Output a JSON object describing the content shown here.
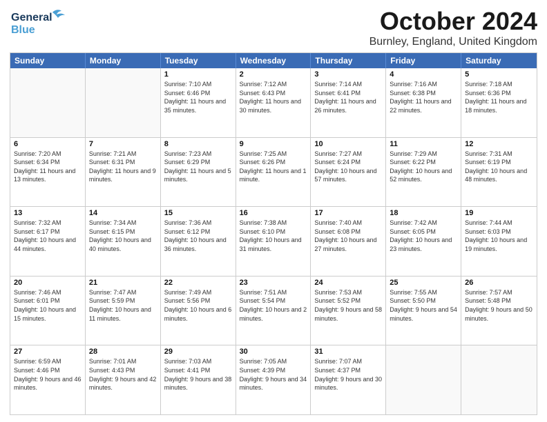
{
  "header": {
    "logo_line1": "General",
    "logo_line2": "Blue",
    "title": "October 2024",
    "subtitle": "Burnley, England, United Kingdom"
  },
  "calendar": {
    "days": [
      "Sunday",
      "Monday",
      "Tuesday",
      "Wednesday",
      "Thursday",
      "Friday",
      "Saturday"
    ],
    "rows": [
      [
        {
          "day": "",
          "sunrise": "",
          "sunset": "",
          "daylight": "",
          "empty": true
        },
        {
          "day": "",
          "sunrise": "",
          "sunset": "",
          "daylight": "",
          "empty": true
        },
        {
          "day": "1",
          "sunrise": "Sunrise: 7:10 AM",
          "sunset": "Sunset: 6:46 PM",
          "daylight": "Daylight: 11 hours and 35 minutes."
        },
        {
          "day": "2",
          "sunrise": "Sunrise: 7:12 AM",
          "sunset": "Sunset: 6:43 PM",
          "daylight": "Daylight: 11 hours and 30 minutes."
        },
        {
          "day": "3",
          "sunrise": "Sunrise: 7:14 AM",
          "sunset": "Sunset: 6:41 PM",
          "daylight": "Daylight: 11 hours and 26 minutes."
        },
        {
          "day": "4",
          "sunrise": "Sunrise: 7:16 AM",
          "sunset": "Sunset: 6:38 PM",
          "daylight": "Daylight: 11 hours and 22 minutes."
        },
        {
          "day": "5",
          "sunrise": "Sunrise: 7:18 AM",
          "sunset": "Sunset: 6:36 PM",
          "daylight": "Daylight: 11 hours and 18 minutes."
        }
      ],
      [
        {
          "day": "6",
          "sunrise": "Sunrise: 7:20 AM",
          "sunset": "Sunset: 6:34 PM",
          "daylight": "Daylight: 11 hours and 13 minutes."
        },
        {
          "day": "7",
          "sunrise": "Sunrise: 7:21 AM",
          "sunset": "Sunset: 6:31 PM",
          "daylight": "Daylight: 11 hours and 9 minutes."
        },
        {
          "day": "8",
          "sunrise": "Sunrise: 7:23 AM",
          "sunset": "Sunset: 6:29 PM",
          "daylight": "Daylight: 11 hours and 5 minutes."
        },
        {
          "day": "9",
          "sunrise": "Sunrise: 7:25 AM",
          "sunset": "Sunset: 6:26 PM",
          "daylight": "Daylight: 11 hours and 1 minute."
        },
        {
          "day": "10",
          "sunrise": "Sunrise: 7:27 AM",
          "sunset": "Sunset: 6:24 PM",
          "daylight": "Daylight: 10 hours and 57 minutes."
        },
        {
          "day": "11",
          "sunrise": "Sunrise: 7:29 AM",
          "sunset": "Sunset: 6:22 PM",
          "daylight": "Daylight: 10 hours and 52 minutes."
        },
        {
          "day": "12",
          "sunrise": "Sunrise: 7:31 AM",
          "sunset": "Sunset: 6:19 PM",
          "daylight": "Daylight: 10 hours and 48 minutes."
        }
      ],
      [
        {
          "day": "13",
          "sunrise": "Sunrise: 7:32 AM",
          "sunset": "Sunset: 6:17 PM",
          "daylight": "Daylight: 10 hours and 44 minutes."
        },
        {
          "day": "14",
          "sunrise": "Sunrise: 7:34 AM",
          "sunset": "Sunset: 6:15 PM",
          "daylight": "Daylight: 10 hours and 40 minutes."
        },
        {
          "day": "15",
          "sunrise": "Sunrise: 7:36 AM",
          "sunset": "Sunset: 6:12 PM",
          "daylight": "Daylight: 10 hours and 36 minutes."
        },
        {
          "day": "16",
          "sunrise": "Sunrise: 7:38 AM",
          "sunset": "Sunset: 6:10 PM",
          "daylight": "Daylight: 10 hours and 31 minutes."
        },
        {
          "day": "17",
          "sunrise": "Sunrise: 7:40 AM",
          "sunset": "Sunset: 6:08 PM",
          "daylight": "Daylight: 10 hours and 27 minutes."
        },
        {
          "day": "18",
          "sunrise": "Sunrise: 7:42 AM",
          "sunset": "Sunset: 6:05 PM",
          "daylight": "Daylight: 10 hours and 23 minutes."
        },
        {
          "day": "19",
          "sunrise": "Sunrise: 7:44 AM",
          "sunset": "Sunset: 6:03 PM",
          "daylight": "Daylight: 10 hours and 19 minutes."
        }
      ],
      [
        {
          "day": "20",
          "sunrise": "Sunrise: 7:46 AM",
          "sunset": "Sunset: 6:01 PM",
          "daylight": "Daylight: 10 hours and 15 minutes."
        },
        {
          "day": "21",
          "sunrise": "Sunrise: 7:47 AM",
          "sunset": "Sunset: 5:59 PM",
          "daylight": "Daylight: 10 hours and 11 minutes."
        },
        {
          "day": "22",
          "sunrise": "Sunrise: 7:49 AM",
          "sunset": "Sunset: 5:56 PM",
          "daylight": "Daylight: 10 hours and 6 minutes."
        },
        {
          "day": "23",
          "sunrise": "Sunrise: 7:51 AM",
          "sunset": "Sunset: 5:54 PM",
          "daylight": "Daylight: 10 hours and 2 minutes."
        },
        {
          "day": "24",
          "sunrise": "Sunrise: 7:53 AM",
          "sunset": "Sunset: 5:52 PM",
          "daylight": "Daylight: 9 hours and 58 minutes."
        },
        {
          "day": "25",
          "sunrise": "Sunrise: 7:55 AM",
          "sunset": "Sunset: 5:50 PM",
          "daylight": "Daylight: 9 hours and 54 minutes."
        },
        {
          "day": "26",
          "sunrise": "Sunrise: 7:57 AM",
          "sunset": "Sunset: 5:48 PM",
          "daylight": "Daylight: 9 hours and 50 minutes."
        }
      ],
      [
        {
          "day": "27",
          "sunrise": "Sunrise: 6:59 AM",
          "sunset": "Sunset: 4:46 PM",
          "daylight": "Daylight: 9 hours and 46 minutes."
        },
        {
          "day": "28",
          "sunrise": "Sunrise: 7:01 AM",
          "sunset": "Sunset: 4:43 PM",
          "daylight": "Daylight: 9 hours and 42 minutes."
        },
        {
          "day": "29",
          "sunrise": "Sunrise: 7:03 AM",
          "sunset": "Sunset: 4:41 PM",
          "daylight": "Daylight: 9 hours and 38 minutes."
        },
        {
          "day": "30",
          "sunrise": "Sunrise: 7:05 AM",
          "sunset": "Sunset: 4:39 PM",
          "daylight": "Daylight: 9 hours and 34 minutes."
        },
        {
          "day": "31",
          "sunrise": "Sunrise: 7:07 AM",
          "sunset": "Sunset: 4:37 PM",
          "daylight": "Daylight: 9 hours and 30 minutes."
        },
        {
          "day": "",
          "sunrise": "",
          "sunset": "",
          "daylight": "",
          "empty": true
        },
        {
          "day": "",
          "sunrise": "",
          "sunset": "",
          "daylight": "",
          "empty": true
        }
      ]
    ]
  }
}
